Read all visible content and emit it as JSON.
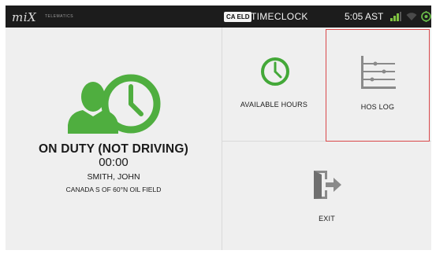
{
  "topbar": {
    "logo_text": "miX",
    "logo_sub": "TELEMATICS",
    "badge": "CA ELD",
    "title": "TIMECLOCK",
    "time": "5:05 AST",
    "icons": [
      "signal-bars-icon",
      "wifi-icon",
      "gps-icon"
    ],
    "colors": {
      "background": "#1c1c1c",
      "signal": "#7fc241",
      "gps": "#6cc24a"
    }
  },
  "status": {
    "duty_status": "ON DUTY (NOT DRIVING)",
    "time": "00:00",
    "driver_name": "SMITH, JOHN",
    "location": "CANADA S OF 60°N OIL FIELD",
    "icon": "driver-clock-icon",
    "icon_color": "#4fae3f"
  },
  "tiles": {
    "available_hours": {
      "label": "AVAILABLE HOURS",
      "icon": "clock-icon",
      "color": "#43a838"
    },
    "hos_log": {
      "label": "HOS LOG",
      "icon": "hos-log-icon",
      "color": "#8a8a8a",
      "selected": true,
      "selected_border": "#d9484a"
    },
    "exit": {
      "label": "EXIT",
      "icon": "exit-door-icon",
      "color": "#8a8a8a"
    }
  }
}
